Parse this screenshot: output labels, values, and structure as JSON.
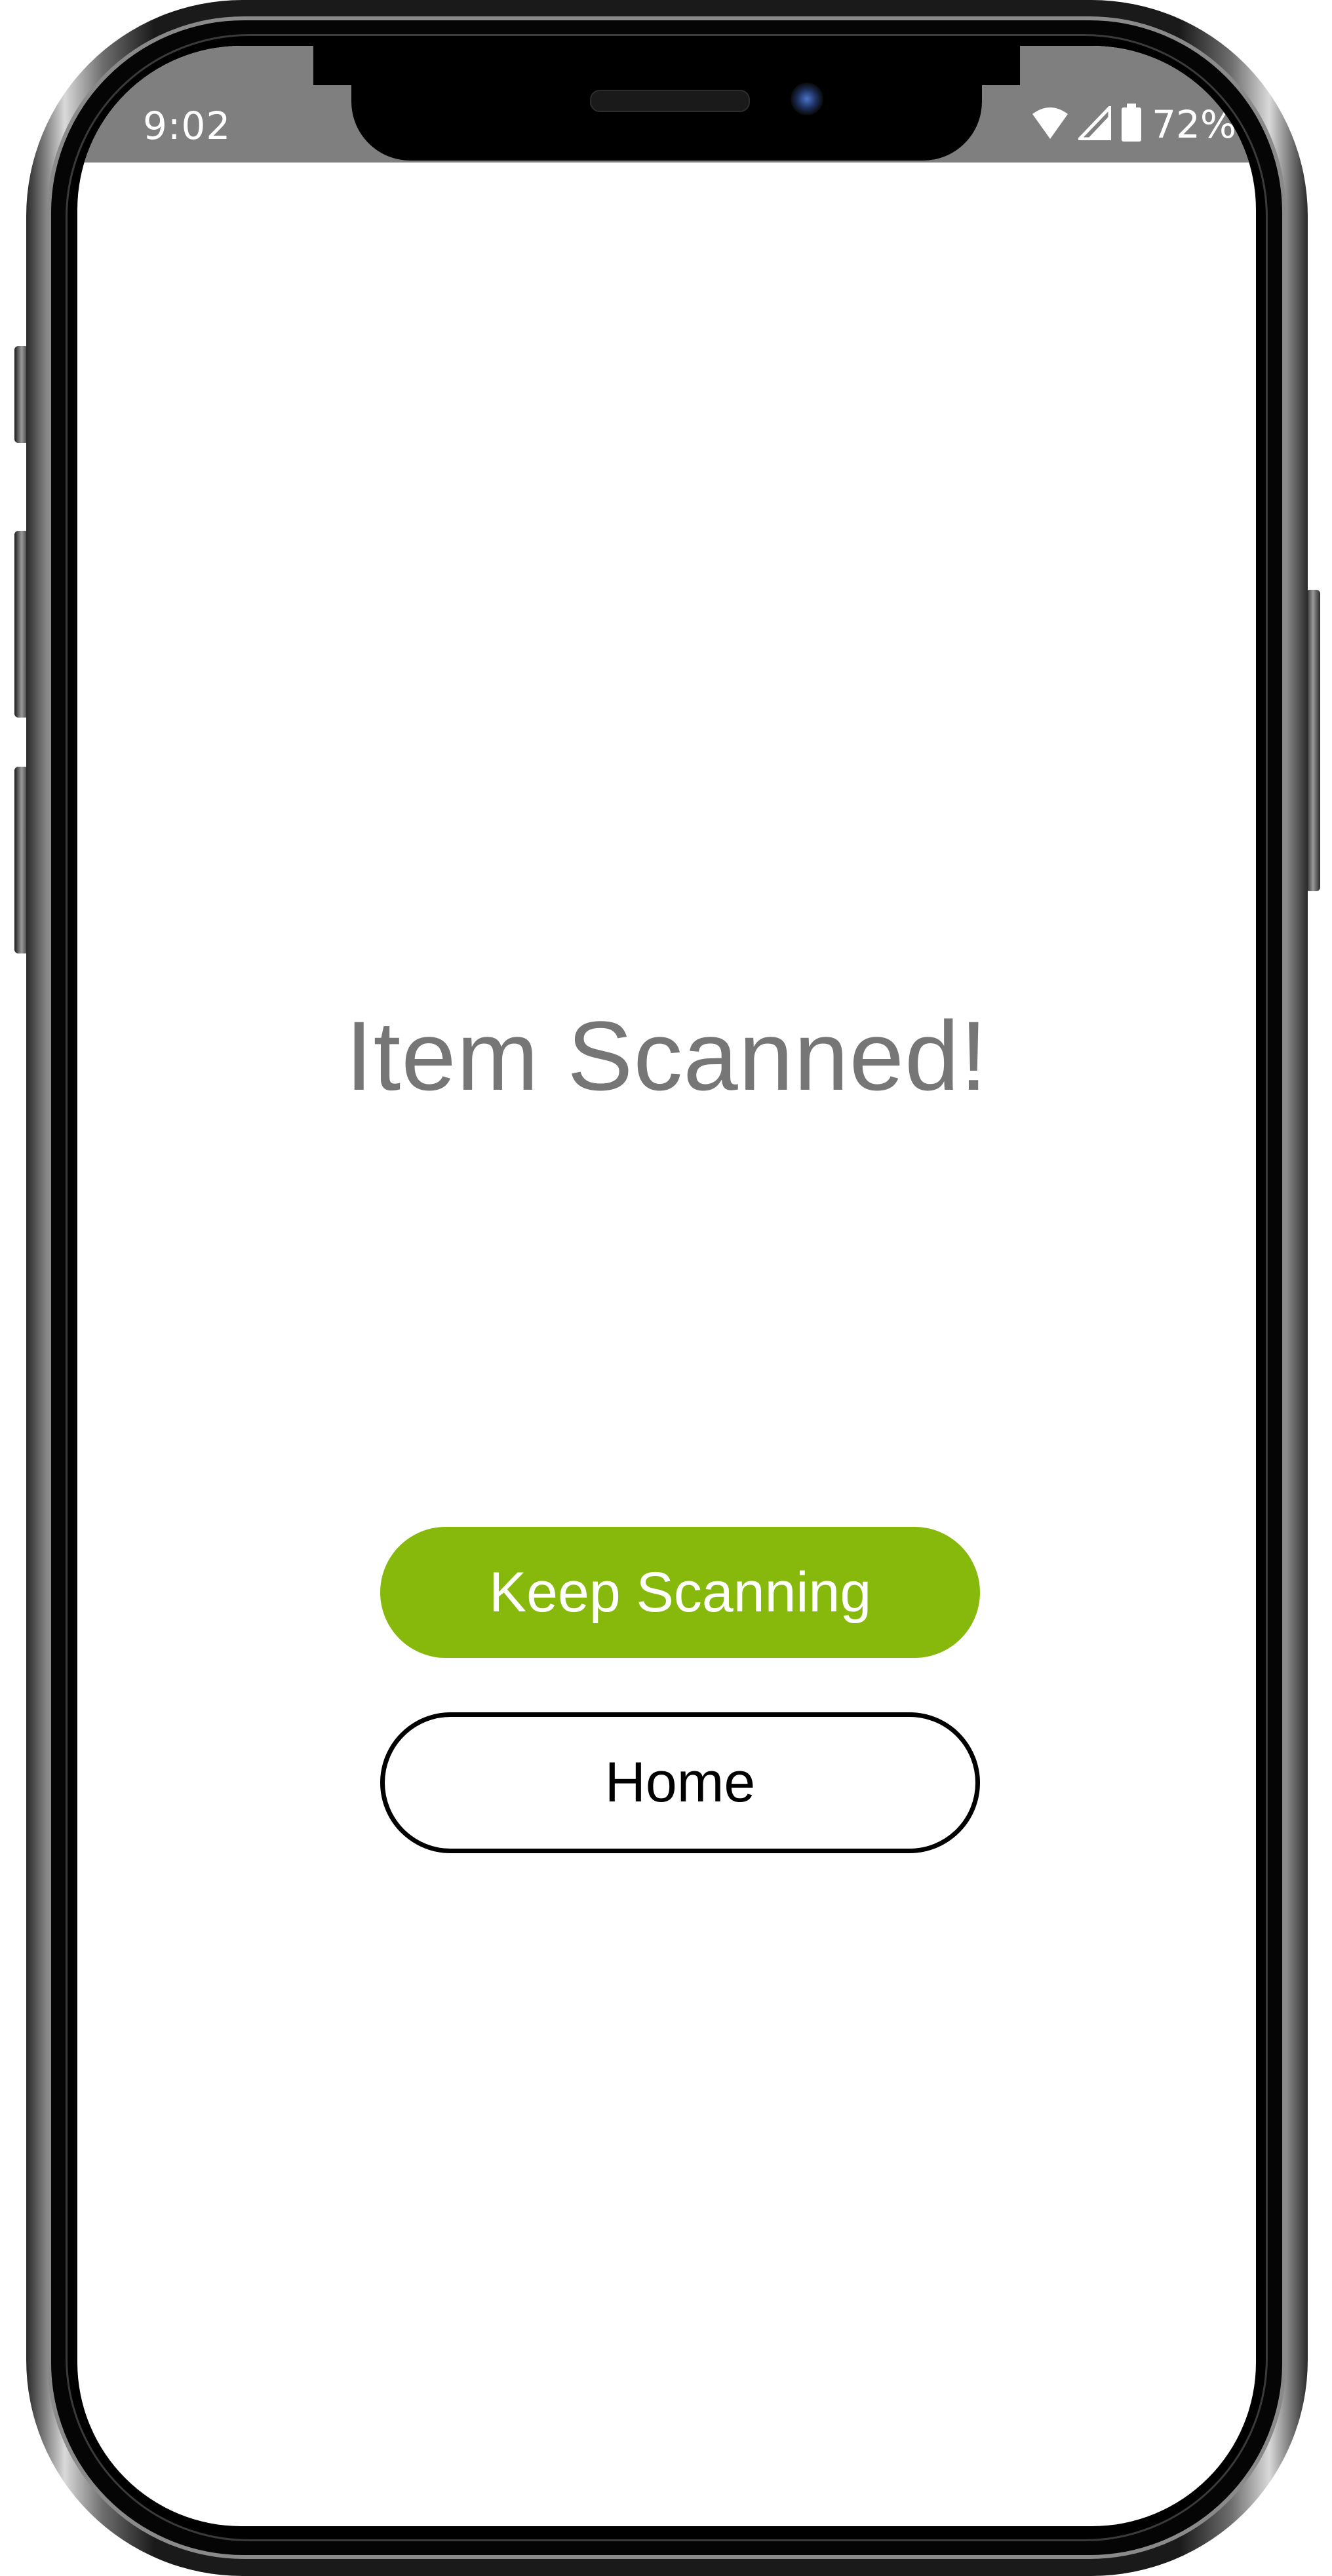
{
  "status_bar": {
    "time": "9:02",
    "battery_percent": "72%",
    "icons": [
      "wifi-icon",
      "cellular-signal-icon",
      "battery-icon"
    ],
    "background_color": "#7f7f7f"
  },
  "screen": {
    "title": "Item Scanned!",
    "keep_scanning_label": "Keep Scanning",
    "home_label": "Home",
    "accent_color": "#86b90c"
  }
}
